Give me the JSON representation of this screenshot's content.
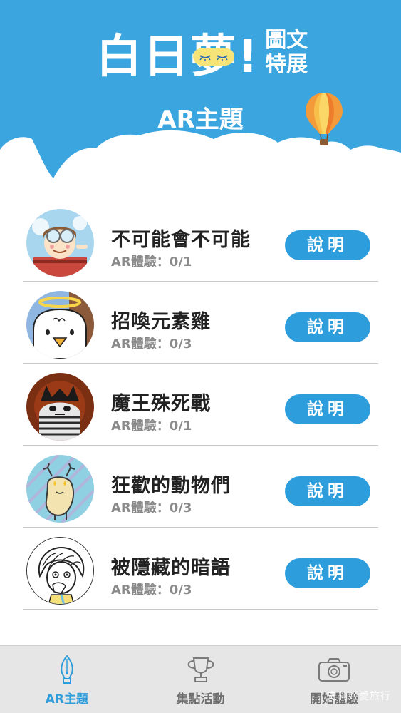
{
  "header": {
    "logo_main_1": "白日",
    "logo_main_2": "夢",
    "logo_main_3": "!",
    "logo_sub_1": "圖文",
    "logo_sub_2": "特展",
    "page_title": "AR主題"
  },
  "themes": [
    {
      "title": "不可能會不可能",
      "progress": "AR體驗：0/1",
      "button": "說明",
      "avatar": "pilot-character-avatar"
    },
    {
      "title": "招喚元素雞",
      "progress": "AR體驗：0/3",
      "button": "說明",
      "avatar": "angel-chicken-avatar"
    },
    {
      "title": "魔王殊死戰",
      "progress": "AR體驗：0/1",
      "button": "說明",
      "avatar": "demon-king-avatar"
    },
    {
      "title": "狂歡的動物們",
      "progress": "AR體驗：0/3",
      "button": "說明",
      "avatar": "deer-animal-avatar"
    },
    {
      "title": "被隱藏的暗語",
      "progress": "AR體驗：0/3",
      "button": "說明",
      "avatar": "girl-sketch-avatar"
    }
  ],
  "tabs": [
    {
      "label": "AR主題",
      "icon": "pen-nib-icon",
      "active": true
    },
    {
      "label": "集點活動",
      "icon": "trophy-icon",
      "active": false
    },
    {
      "label": "開始體驗",
      "icon": "camera-icon",
      "active": false
    }
  ],
  "watermark": "史莉姬愛旅行",
  "colors": {
    "header_blue": "#3aa5df",
    "accent_blue": "#2e9ddb",
    "tab_bar": "#e6e6e6",
    "mask_yellow": "#f6e479"
  }
}
